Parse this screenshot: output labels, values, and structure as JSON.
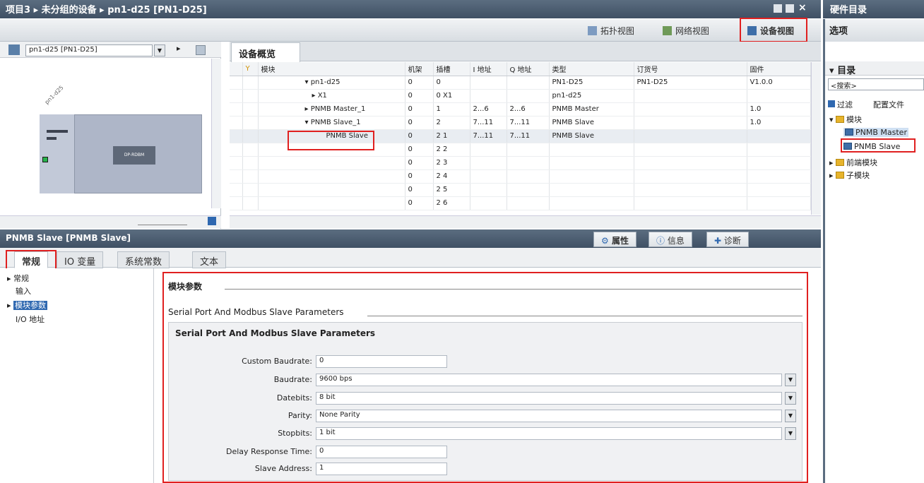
{
  "title_bar": {
    "breadcrumb": "项目3 ▸ 未分组的设备 ▸ pn1-d25 [PN1-D25]"
  },
  "right_title": "硬件目录",
  "views": {
    "topology": "拓扑视图",
    "network": "网络视图",
    "device": "设备视图"
  },
  "left_toolbar": {
    "device_select": "pn1-d25 [PN1-D25]"
  },
  "canvas": {
    "device_label": "pn1-d25",
    "module_label": "DP-RDBM"
  },
  "overview_tab": "设备概览",
  "grid": {
    "headers": [
      "模块",
      "机架",
      "插槽",
      "I 地址",
      "Q 地址",
      "类型",
      "订货号",
      "固件"
    ],
    "rows": [
      {
        "module": "▾ pn1-d25",
        "rack": "0",
        "slot": "0",
        "i": "",
        "q": "",
        "type": "PN1-D25",
        "order": "PN1-D25",
        "fw": "V1.0.0"
      },
      {
        "module": "▸ X1",
        "rack": "0",
        "slot": "0 X1",
        "i": "",
        "q": "",
        "type": "pn1-d25",
        "order": "",
        "fw": ""
      },
      {
        "module": "▸ PNMB Master_1",
        "rack": "0",
        "slot": "1",
        "i": "2...6",
        "q": "2...6",
        "type": "PNMB Master",
        "order": "",
        "fw": "1.0"
      },
      {
        "module": "▾ PNMB Slave_1",
        "rack": "0",
        "slot": "2",
        "i": "7...11",
        "q": "7...11",
        "type": "PNMB Slave",
        "order": "",
        "fw": "1.0"
      },
      {
        "module": "PNMB Slave",
        "rack": "0",
        "slot": "2 1",
        "i": "7...11",
        "q": "7...11",
        "type": "PNMB Slave",
        "order": "",
        "fw": ""
      },
      {
        "module": "",
        "rack": "0",
        "slot": "2 2",
        "i": "",
        "q": "",
        "type": "",
        "order": "",
        "fw": ""
      },
      {
        "module": "",
        "rack": "0",
        "slot": "2 3",
        "i": "",
        "q": "",
        "type": "",
        "order": "",
        "fw": ""
      },
      {
        "module": "",
        "rack": "0",
        "slot": "2 4",
        "i": "",
        "q": "",
        "type": "",
        "order": "",
        "fw": ""
      },
      {
        "module": "",
        "rack": "0",
        "slot": "2 5",
        "i": "",
        "q": "",
        "type": "",
        "order": "",
        "fw": ""
      },
      {
        "module": "",
        "rack": "0",
        "slot": "2 6",
        "i": "",
        "q": "",
        "type": "",
        "order": "",
        "fw": ""
      }
    ]
  },
  "properties": {
    "title": "PNMB Slave [PNMB Slave]",
    "tabs": {
      "props": "属性",
      "info": "信息",
      "diag": "诊断"
    },
    "subtabs": [
      "常规",
      "IO 变量",
      "系统常数",
      "文本"
    ],
    "nav": [
      "常规",
      "输入",
      "模块参数",
      "I/O 地址"
    ],
    "section_title": "模块参数",
    "subsection": "Serial Port And Modbus Slave Parameters",
    "box_title": "Serial Port And Modbus Slave Parameters",
    "fields": {
      "custom_baudrate": {
        "label": "Custom Baudrate:",
        "value": "0"
      },
      "baudrate": {
        "label": "Baudrate:",
        "value": "9600 bps"
      },
      "databits": {
        "label": "Datebits:",
        "value": "8 bit"
      },
      "parity": {
        "label": "Parity:",
        "value": "None Parity"
      },
      "stopbits": {
        "label": "Stopbits:",
        "value": "1 bit"
      },
      "delay": {
        "label": "Delay Response Time:",
        "value": "0"
      },
      "slave_addr": {
        "label": "Slave Address:",
        "value": "1"
      }
    }
  },
  "catalog": {
    "options": "选项",
    "catalog": "目录",
    "search": "<搜索>",
    "filter": "过滤",
    "profile": "配置文件",
    "tree": {
      "modules": "模块",
      "master": "PNMB Master",
      "slave": "PNMB Slave",
      "head": "前端模块",
      "sub": "子模块"
    }
  },
  "colors": {
    "highlight": "#e02020",
    "titlebar": "#4c5d70"
  }
}
